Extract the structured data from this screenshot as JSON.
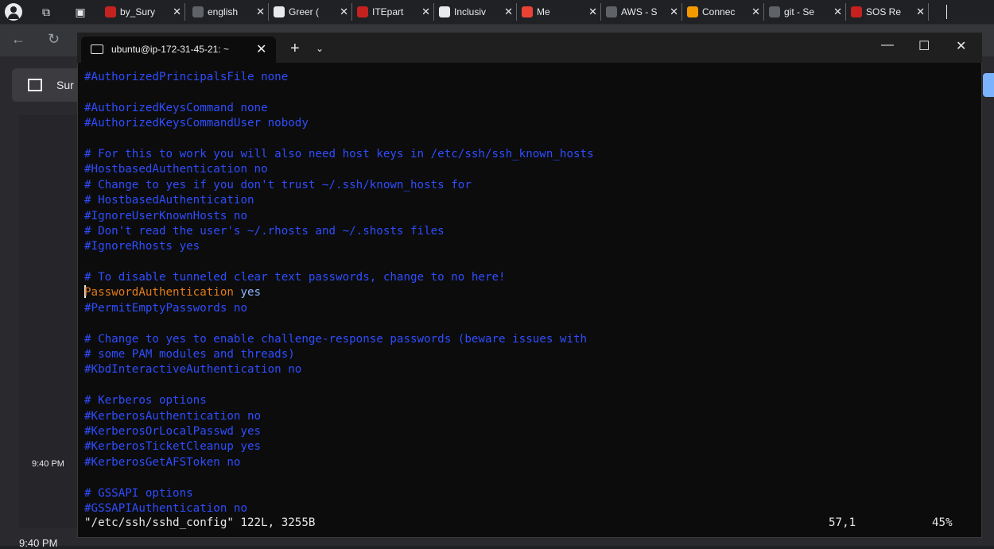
{
  "browser_tabs": [
    {
      "label": "by_Sury",
      "fav_color": "#c5221f"
    },
    {
      "label": "english",
      "fav_color": "#5f6368"
    },
    {
      "label": "Greer (",
      "fav_color": "#e8eaed"
    },
    {
      "label": "ITEpart",
      "fav_color": "#c5221f"
    },
    {
      "label": "Inclusiv",
      "fav_color": "#e8eaed"
    },
    {
      "label": "Me",
      "fav_color": "#ea4335"
    },
    {
      "label": "AWS - S",
      "fav_color": "#5f6368"
    },
    {
      "label": "Connec",
      "fav_color": "#f29900"
    },
    {
      "label": "git - Se",
      "fav_color": "#5f6368"
    },
    {
      "label": "SOS Re",
      "fav_color": "#c5221f"
    }
  ],
  "tab_close_glyph": "✕",
  "background": {
    "card_label": "Sur",
    "time_small": "9:40 PM",
    "time_bottom": "9:40 PM"
  },
  "terminal": {
    "tab_title": "ubuntu@ip-172-31-45-21: ~",
    "tab_close": "✕",
    "new_tab": "+",
    "dropdown": "⌄",
    "minimize": "—",
    "maximize": "☐",
    "close": "✕",
    "lines": [
      {
        "kind": "comment",
        "text": "#AuthorizedPrincipalsFile none"
      },
      {
        "kind": "blank",
        "text": ""
      },
      {
        "kind": "comment",
        "text": "#AuthorizedKeysCommand none"
      },
      {
        "kind": "comment",
        "text": "#AuthorizedKeysCommandUser nobody"
      },
      {
        "kind": "blank",
        "text": ""
      },
      {
        "kind": "comment",
        "text": "# For this to work you will also need host keys in /etc/ssh/ssh_known_hosts"
      },
      {
        "kind": "comment",
        "text": "#HostbasedAuthentication no"
      },
      {
        "kind": "comment",
        "text": "# Change to yes if you don't trust ~/.ssh/known_hosts for"
      },
      {
        "kind": "comment",
        "text": "# HostbasedAuthentication"
      },
      {
        "kind": "comment",
        "text": "#IgnoreUserKnownHosts no"
      },
      {
        "kind": "comment",
        "text": "# Don't read the user's ~/.rhosts and ~/.shosts files"
      },
      {
        "kind": "comment",
        "text": "#IgnoreRhosts yes"
      },
      {
        "kind": "blank",
        "text": ""
      },
      {
        "kind": "comment",
        "text": "# To disable tunneled clear text passwords, change to no here!"
      },
      {
        "kind": "directive",
        "key": "PasswordAuthentication",
        "value": "yes"
      },
      {
        "kind": "comment",
        "text": "#PermitEmptyPasswords no"
      },
      {
        "kind": "blank",
        "text": ""
      },
      {
        "kind": "comment",
        "text": "# Change to yes to enable challenge-response passwords (beware issues with"
      },
      {
        "kind": "comment",
        "text": "# some PAM modules and threads)"
      },
      {
        "kind": "comment",
        "text": "#KbdInteractiveAuthentication no"
      },
      {
        "kind": "blank",
        "text": ""
      },
      {
        "kind": "comment",
        "text": "# Kerberos options"
      },
      {
        "kind": "comment",
        "text": "#KerberosAuthentication no"
      },
      {
        "kind": "comment",
        "text": "#KerberosOrLocalPasswd yes"
      },
      {
        "kind": "comment",
        "text": "#KerberosTicketCleanup yes"
      },
      {
        "kind": "comment",
        "text": "#KerberosGetAFSToken no"
      },
      {
        "kind": "blank",
        "text": ""
      },
      {
        "kind": "comment",
        "text": "# GSSAPI options"
      },
      {
        "kind": "comment",
        "text": "#GSSAPIAuthentication no"
      }
    ],
    "status_file": "\"/etc/ssh/sshd_config\" 122L, 3255B",
    "status_position": "57,1",
    "status_percent": "45%"
  },
  "colors": {
    "comment": "#2f4dff",
    "directive_key": "#e07b1a",
    "directive_value": "#8fb5ff",
    "terminal_bg": "#0c0c0c"
  }
}
